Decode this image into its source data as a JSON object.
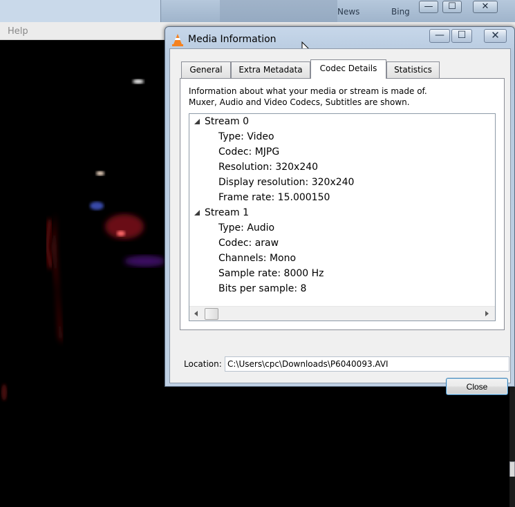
{
  "background": {
    "window_controls": {
      "minimize": "—",
      "maximize": "☐",
      "close": "✕"
    },
    "taskbar_links": [
      "News",
      "Bing"
    ],
    "player_menu": {
      "help": "Help"
    }
  },
  "dialog": {
    "title": "Media Information",
    "icon": "vlc-cone-icon",
    "controls": {
      "minimize": "—",
      "maximize": "☐",
      "close": "✕"
    },
    "tabs": [
      {
        "label": "General",
        "selected": false
      },
      {
        "label": "Extra Metadata",
        "selected": false
      },
      {
        "label": "Codec Details",
        "selected": true
      },
      {
        "label": "Statistics",
        "selected": false
      }
    ],
    "info": {
      "line1": "Information about what your media or stream is made of.",
      "line2": "Muxer, Audio and Video Codecs, Subtitles are shown."
    },
    "streams": [
      {
        "label": "Stream 0",
        "expanded": true,
        "properties": [
          "Type: Video",
          "Codec: MJPG",
          "Resolution: 320x240",
          "Display resolution: 320x240",
          "Frame rate: 15.000150"
        ]
      },
      {
        "label": "Stream 1",
        "expanded": true,
        "properties": [
          "Type: Audio",
          "Codec: araw",
          "Channels: Mono",
          "Sample rate: 8000 Hz",
          "Bits per sample: 8"
        ]
      }
    ],
    "location": {
      "label": "Location:",
      "value": "C:\\Users\\cpc\\Downloads\\P6040093.AVI"
    },
    "close_button": "Close"
  },
  "colors": {
    "dialog_frame": "#b7cadf",
    "video_bg": "#000000",
    "default_button_border": "#3c7fb1"
  }
}
